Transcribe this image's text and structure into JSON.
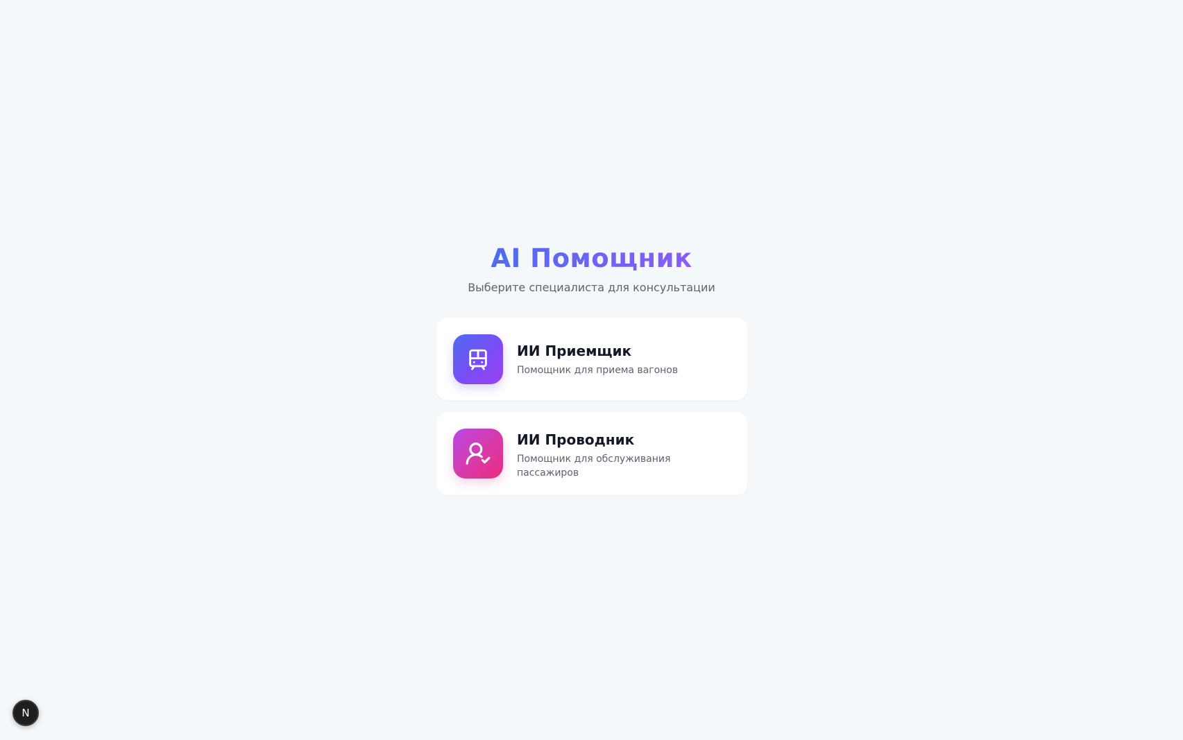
{
  "header": {
    "title": "AI Помощник",
    "subtitle": "Выберите специалиста для консультации"
  },
  "cards": [
    {
      "title": "ИИ Приемщик",
      "description": "Помощник для приема вагонов",
      "icon": "train-icon",
      "gradient": [
        "#4f6bf2",
        "#9b3ff0"
      ]
    },
    {
      "title": "ИИ Проводник",
      "description": "Помощник для обслуживания пассажиров",
      "icon": "user-check-icon",
      "gradient": [
        "#b847e6",
        "#ec2b7f"
      ]
    }
  ],
  "dev_badge": {
    "label": "N",
    "icon": "nextjs-icon"
  },
  "colors": {
    "background": "#f5f8fb",
    "title_gradient_start": "#4f6bf0",
    "title_gradient_end": "#8a5cf6",
    "card_background": "#ffffff",
    "text_primary": "#121826",
    "text_secondary": "#5b6270"
  }
}
